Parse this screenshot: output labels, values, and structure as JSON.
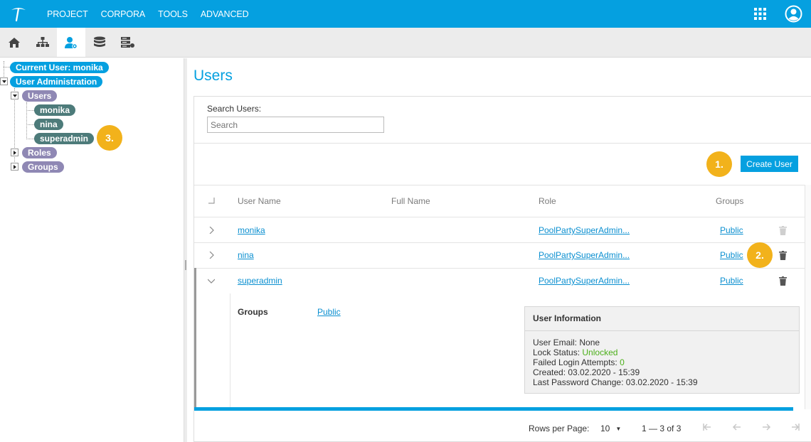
{
  "topnav": {
    "items": [
      "PROJECT",
      "CORPORA",
      "TOOLS",
      "ADVANCED"
    ]
  },
  "tree": {
    "current_user": "Current User: monika",
    "user_admin": "User Administration",
    "users": "Users",
    "user_nodes": [
      "monika",
      "nina",
      "superadmin"
    ],
    "roles": "Roles",
    "groups": "Groups"
  },
  "badges": [
    "1.",
    "2.",
    "3."
  ],
  "main": {
    "title": "Users",
    "search_label": "Search Users:",
    "search_placeholder": "Search",
    "create_button": "Create User",
    "columns": [
      "User Name",
      "Full Name",
      "Role",
      "Groups"
    ],
    "rows": [
      {
        "user": "monika",
        "role": "PoolPartySuperAdmin",
        "groups": "Public"
      },
      {
        "user": "nina",
        "role": "PoolPartySuperAdmin",
        "groups": "Public"
      },
      {
        "user": "superadmin",
        "role": "PoolPartySuperAdmin",
        "groups": "Public"
      }
    ],
    "role_ellipsis": "...",
    "expanded": {
      "groups_label": "Groups",
      "groups_value": "Public",
      "info_title": "User Information",
      "email_label": "User Email:",
      "email_value": "None",
      "lock_label": "Lock Status:",
      "lock_value": "Unlocked",
      "failed_label": "Failed Login Attempts:",
      "failed_value": "0",
      "created_label": "Created:",
      "created_value": "03.02.2020 - 15:39",
      "pwchange_label": "Last Password Change:",
      "pwchange_value": "03.02.2020 - 15:39"
    },
    "footer": {
      "rows_per_page_label": "Rows per Page:",
      "rows_per_page_value": "10",
      "range": "1 — 3 of 3"
    }
  },
  "colors": {
    "brand_blue": "#05a0e0",
    "node_purple": "#8f88b4",
    "node_teal": "#4d7b7a",
    "badge_yellow": "#f2b21b",
    "unlocked_green": "#4caf1a"
  }
}
